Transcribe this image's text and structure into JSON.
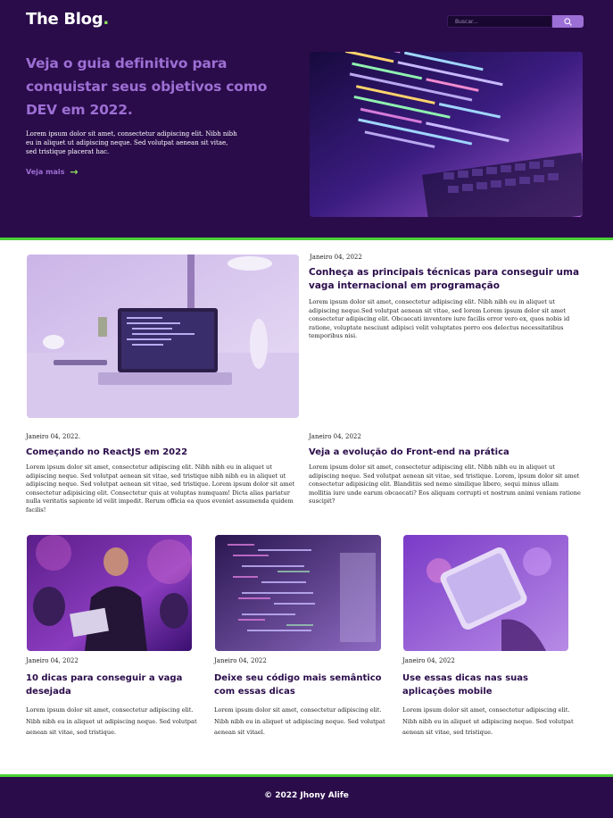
{
  "header": {
    "logo": "The Blog",
    "logo_dot": ".",
    "search": {
      "placeholder": "Buscar..."
    }
  },
  "hero": {
    "title": "Veja o guia definitivo para conquistar seus objetivos como DEV em 2022.",
    "text": "Lorem ipsum dolor sit amet, consectetur adipiscing elit. Nibh nibh eu in aliquet ut adipiscing neque. Sed volutpat aenean sit vitae, sed tristique placerat hac.",
    "link": "Veja mais",
    "link_icon": "arrow-right-icon"
  },
  "featured": {
    "date": "Janeiro 04, 2022",
    "title": "Conheça as principais técnicas para conseguir uma vaga internacional em programação",
    "text": "Lorem ipsum dolor sit amet, consectetur adipiscing elit. Nibh nibh eu in aliquet ut adipiscing neque.Sed volutpat aenean sit vitae, sed lorem Lorem ipsum dolor sit amet consectetur adipiscing elit. Obcaecati inventore iure facilis error vero ex, quos nobis id ratione, voluptate nesciunt adipisci velit voluptates porro eos delectus necessitatibus temporibus nisi."
  },
  "posts_row2": [
    {
      "date": "Janeiro 04, 2022.",
      "title": "Começando no ReactJS em 2022",
      "text": "Lorem ipsum dolor sit amet, consectetur adipiscing elit. Nibh nibh eu in aliquet ut adipiscing neque. Sed volutpat aenean sit vitae, sed tristique nibh nibh eu in aliquet ut adipiscing neque. Sed volutpat aenean sit vitae, sed tristique. Lorem ipsum dolor sit amet consectetur adipisicing elit. Consectetur quis at voluptas numquam! Dicta alias pariatur nulla veritatis sapiente id velit impedit. Rerum officia ea quos eveniet assumenda quidem facilis!"
    },
    {
      "date": "Janeiro 04, 2022",
      "title": "Veja a evolução do Front-end na prática",
      "text": "Lorem ipsum dolor sit amet, consectetur adipiscing elit. Nibh nibh eu in aliquet ut adipiscing neque. Sed volutpat aenean sit vitae, sed tristique. Lorem, ipsum dolor sit amet consectetur adipisicing elit. Blanditiis sed nemo similique libero, sequi minus ullam mollitia iure unde earum obcaecati? Eos aliquam corrupti et nostrum animi veniam ratione suscipit?"
    }
  ],
  "posts_row3": [
    {
      "date": "Janeiro 04, 2022",
      "title": "10 dicas para conseguir a vaga desejada",
      "text": "Lorem ipsum dolor sit amet, consectetur adipiscing elit. Nibh nibh eu in aliquet ut adipiscing neque. Sed volutpat aenean sit vitae, sed tristique."
    },
    {
      "date": "Janeiro 04, 2022",
      "title": "Deixe seu código mais semântico com essas dicas",
      "text": "Lorem ipsum dolor sit amet, consectetur adipiscing elit. Nibh nibh eu in aliquet ut adipiscing neque. Sed volutpat aenean sit vitael."
    },
    {
      "date": "Janeiro 04, 2022",
      "title": "Use essas dicas nas suas aplicações mobile",
      "text": "Lorem ipsum dolor sit amet, consectetur adipiscing elit. Nibh nibh eu in aliquet ut adipiscing neque. Sed volutpat aenean sit vitae, sed tristique."
    }
  ],
  "footer": {
    "copyright": "© 2022 Jhony Alife"
  },
  "colors": {
    "primary": "#2a0c4a",
    "accent_purple": "#9d6fd4",
    "accent_green": "#4cd137"
  }
}
